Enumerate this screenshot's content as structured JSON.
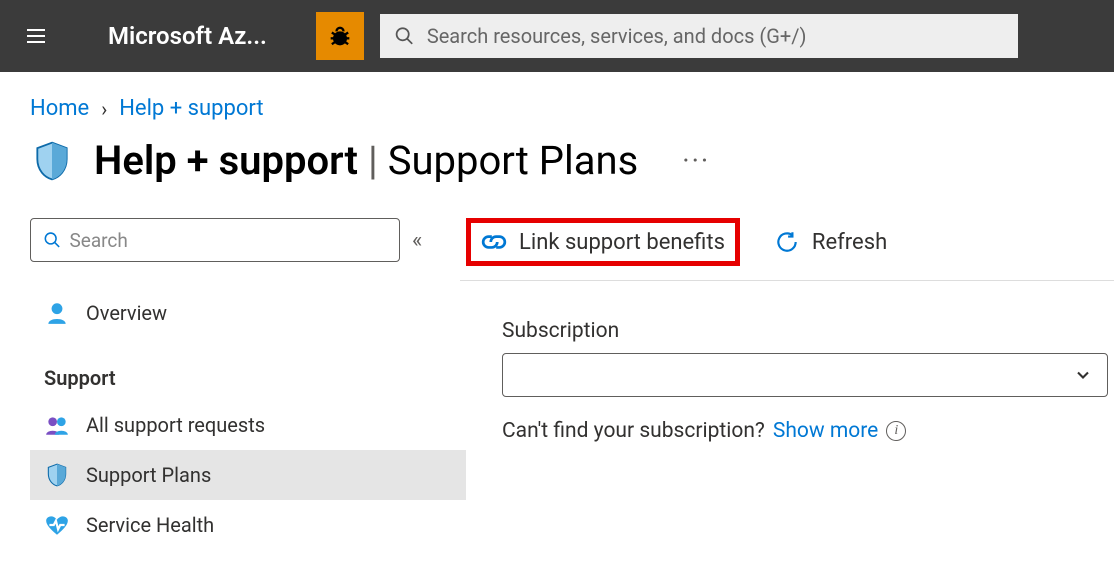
{
  "topbar": {
    "brand": "Microsoft Az...",
    "search_placeholder": "Search resources, services, and docs (G+/)"
  },
  "breadcrumb": {
    "home": "Home",
    "current": "Help + support"
  },
  "page": {
    "title_bold": "Help + support",
    "title_rest": "Support Plans",
    "divider": "|",
    "more": "···"
  },
  "sidebar": {
    "search_placeholder": "Search",
    "collapse_glyph": "«",
    "overview": "Overview",
    "section_support": "Support",
    "items": {
      "all_requests": "All support requests",
      "support_plans": "Support Plans",
      "service_health": "Service Health"
    }
  },
  "toolbar": {
    "link_benefits": "Link support benefits",
    "refresh": "Refresh"
  },
  "main": {
    "subscription_label": "Subscription",
    "cant_find": "Can't find your subscription?",
    "show_more": "Show more"
  }
}
